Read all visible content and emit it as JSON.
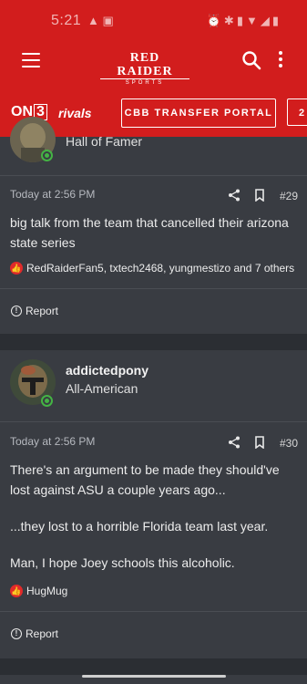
{
  "status": {
    "time": "5:21"
  },
  "header": {
    "logo_line1": "RED RAIDER",
    "logo_line2": "SPORTS",
    "on3": "ON",
    "on3_box": "3",
    "rivals": "rivals",
    "portal_button": "CBB TRANSFER PORTAL",
    "next_button": "2"
  },
  "posts": [
    {
      "user_title": "Hall of Famer",
      "time": "Today at 2:56 PM",
      "number": "#29",
      "lines": [
        "big talk from the team that cancelled their arizona state series"
      ],
      "likes": "RedRaiderFan5, txtech2468, yungmestizo and 7 others",
      "report": "Report"
    },
    {
      "username": "addictedpony",
      "user_title": "All-American",
      "time": "Today at 2:56 PM",
      "number": "#30",
      "lines": [
        "There's an argument to be made they should've lost against ASU a couple years ago...",
        "...they lost to a horrible Florida team last year.",
        "Man, I hope Joey schools this alcoholic."
      ],
      "likes": "HugMug",
      "report": "Report"
    }
  ],
  "colors": {
    "header_red": "#d21d1d",
    "card_bg": "#393c42",
    "page_bg": "#2b2e33",
    "online_green": "#44b344"
  }
}
